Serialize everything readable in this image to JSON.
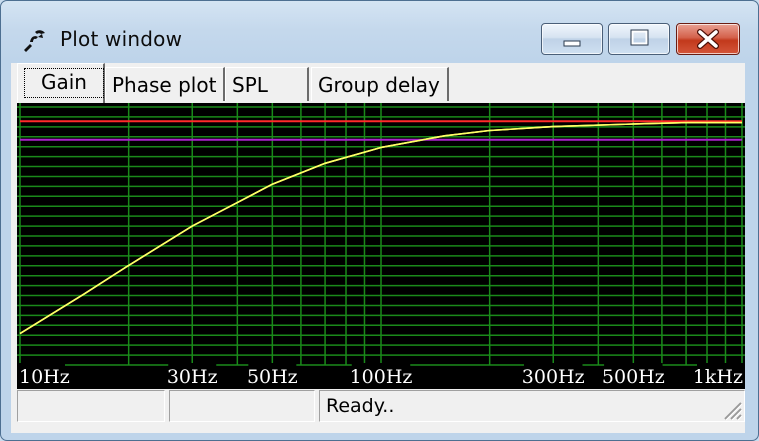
{
  "window": {
    "title": "Plot window"
  },
  "tabs": [
    {
      "label": "Gain",
      "active": true
    },
    {
      "label": "Phase plot",
      "active": false
    },
    {
      "label": "SPL",
      "active": false
    },
    {
      "label": "Group delay",
      "active": false
    }
  ],
  "status": {
    "pane1": "",
    "pane2": "",
    "pane3": "Ready.."
  },
  "chart_data": {
    "type": "line",
    "x_scale": "log",
    "grid": true,
    "x_ticks": [
      "10Hz",
      "30Hz",
      "50Hz",
      "100Hz",
      "300Hz",
      "500Hz",
      "1kHz"
    ],
    "x_tick_values": [
      10,
      30,
      50,
      100,
      300,
      500,
      1000
    ],
    "xlim": [
      10,
      1000
    ],
    "colors": {
      "background": "#000000",
      "grid": "#1a8a1a",
      "gain_curve": "#ffff66",
      "ref_red": "#ff2a2a",
      "ref_purple": "#aa22cc",
      "axis_labels": "#ffffff"
    },
    "series": [
      {
        "color": "#ffff66",
        "x": [
          10,
          15,
          20,
          30,
          40,
          50,
          70,
          100,
          150,
          200,
          300,
          500,
          700,
          1000
        ],
        "y": [
          0.12,
          0.27,
          0.38,
          0.53,
          0.62,
          0.69,
          0.77,
          0.83,
          0.875,
          0.895,
          0.91,
          0.92,
          0.925,
          0.925
        ]
      },
      {
        "color": "#ff2a2a",
        "x": [
          10,
          1000
        ],
        "y": [
          0.93,
          0.93
        ]
      },
      {
        "color": "#aa22cc",
        "x": [
          10,
          1000
        ],
        "y": [
          0.86,
          0.86
        ]
      }
    ]
  }
}
